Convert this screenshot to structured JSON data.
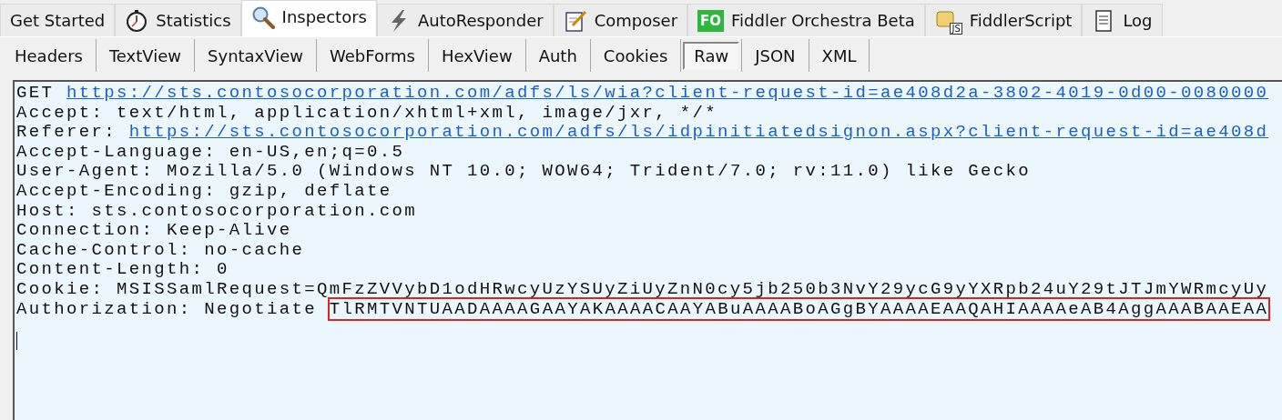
{
  "top_tabs": [
    {
      "label": "Get Started",
      "kind": "none",
      "selected": false
    },
    {
      "label": "Statistics",
      "kind": "stopwatch",
      "selected": false
    },
    {
      "label": "Inspectors",
      "kind": "magnifier",
      "selected": true
    },
    {
      "label": "AutoResponder",
      "kind": "lightning",
      "selected": false
    },
    {
      "label": "Composer",
      "kind": "notepad",
      "selected": false
    },
    {
      "label": "Fiddler Orchestra Beta",
      "kind": "badge",
      "badge": "FO",
      "selected": false
    },
    {
      "label": "FiddlerScript",
      "kind": "scroll",
      "badge": "JS",
      "selected": false
    },
    {
      "label": "Log",
      "kind": "log",
      "selected": false
    }
  ],
  "sub_tabs": [
    {
      "label": "Headers",
      "selected": false
    },
    {
      "label": "TextView",
      "selected": false
    },
    {
      "label": "SyntaxView",
      "selected": false
    },
    {
      "label": "WebForms",
      "selected": false
    },
    {
      "label": "HexView",
      "selected": false
    },
    {
      "label": "Auth",
      "selected": false
    },
    {
      "label": "Cookies",
      "selected": false
    },
    {
      "label": "Raw",
      "selected": true
    },
    {
      "label": "JSON",
      "selected": false
    },
    {
      "label": "XML",
      "selected": false
    }
  ],
  "request_lines": [
    {
      "label": "GET",
      "value": "https://sts.contosocorporation.com/adfs/ls/wia?client-request-id=ae408d2a-3802-4019-0d00-0080000",
      "kind": "link"
    },
    {
      "label": "Accept:",
      "value": "text/html, application/xhtml+xml, image/jxr, */*",
      "kind": "plain"
    },
    {
      "label": "Referer:",
      "value": "https://sts.contosocorporation.com/adfs/ls/idpinitiatedsignon.aspx?client-request-id=ae408d",
      "kind": "link"
    },
    {
      "label": "Accept-Language:",
      "value": "en-US,en;q=0.5",
      "kind": "plain"
    },
    {
      "label": "User-Agent:",
      "value": "Mozilla/5.0 (Windows NT 10.0; WOW64; Trident/7.0; rv:11.0) like Gecko",
      "kind": "plain"
    },
    {
      "label": "Accept-Encoding:",
      "value": "gzip, deflate",
      "kind": "plain"
    },
    {
      "label": "Host:",
      "value": "sts.contosocorporation.com",
      "kind": "plain"
    },
    {
      "label": "Connection:",
      "value": "Keep-Alive",
      "kind": "plain"
    },
    {
      "label": "Cache-Control:",
      "value": "no-cache",
      "kind": "plain"
    },
    {
      "label": "Content-Length:",
      "value": "0",
      "kind": "plain"
    },
    {
      "label": "Cookie:",
      "value": "MSISSamlRequest=QmFzZVVybD1odHRwcyUzYSUyZiUyZnN0cy5jb250b3NvY29ycG9yYXRpb24uY29tJTJmYWRmcyUy",
      "kind": "plain"
    },
    {
      "label": "Authorization:",
      "value": "Negotiate",
      "token": "TlRMTVNTUAADAAAAGAAYAKAAAACAAYABuAAAABoAGgBYAAAAEAAQAHIAAAAeAB4AggAAABAAEAA",
      "kind": "highlighted"
    }
  ]
}
